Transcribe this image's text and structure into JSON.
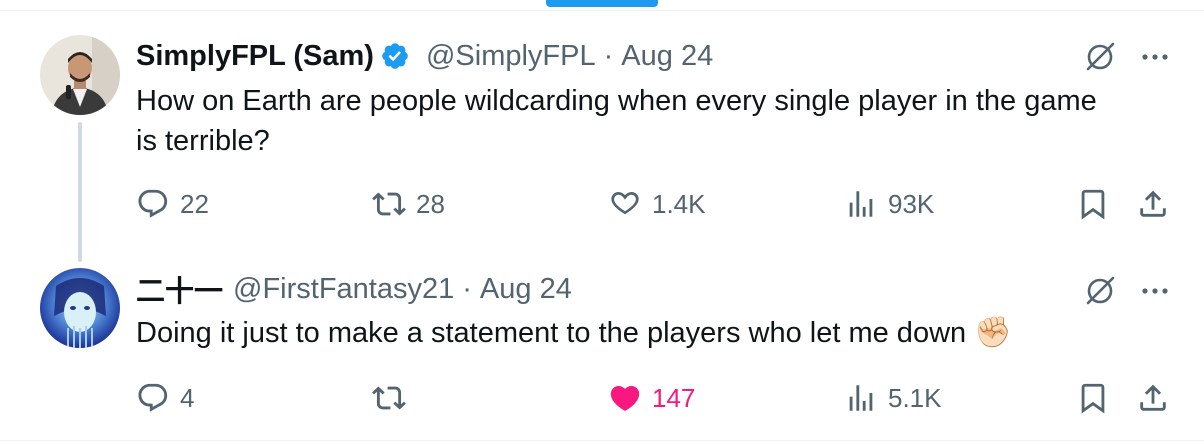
{
  "tweets": [
    {
      "display_name": "SimplyFPL (Sam)",
      "handle": "@SimplyFPL",
      "separator": "·",
      "date": "Aug 24",
      "text_line1": "How on Earth are people wildcarding when every single player in the game",
      "text_line2": "is terrible?",
      "replies": "22",
      "reposts": "28",
      "likes": "1.4K",
      "views": "93K",
      "verified": true
    },
    {
      "display_name": "二十一",
      "handle": "@FirstFantasy21",
      "separator": "·",
      "date": "Aug 24",
      "text_line1": "Doing it just to make a statement to the players who let me down",
      "emoji": "✊🏻",
      "replies": "4",
      "reposts": "",
      "likes": "147",
      "views": "5.1K",
      "liked": true
    }
  ],
  "colors": {
    "accent": "#1d9bf0",
    "like": "#f91880",
    "muted": "#536471",
    "text": "#0f1419",
    "thread_line": "#cfd9de"
  },
  "icons": [
    "verified-badge-icon",
    "grok-icon",
    "more-icon",
    "reply-icon",
    "repost-icon",
    "like-icon",
    "views-icon",
    "bookmark-icon",
    "share-icon"
  ]
}
